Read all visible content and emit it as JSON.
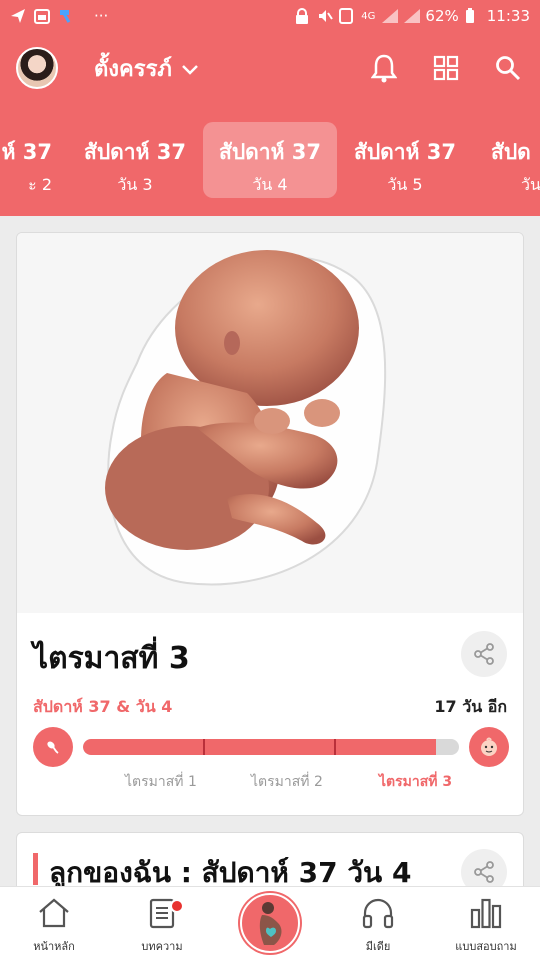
{
  "status_bar": {
    "notification_icons": [
      "paper-plane-icon",
      "calendar-icon",
      "hammer-icon",
      "more-icon"
    ],
    "more": "···",
    "battery": "62%",
    "time": "11:33",
    "network": "4G"
  },
  "app_bar": {
    "profile_name": "ตั้งครรภ์",
    "icons": [
      "bell-icon",
      "grid-icon",
      "search-icon"
    ]
  },
  "day_tabs": [
    {
      "week": "ห์ 37",
      "day": "ะ 2"
    },
    {
      "week": "สัปดาห์ 37",
      "day": "วัน 3"
    },
    {
      "week": "สัปดาห์ 37",
      "day": "วัน 4",
      "active": true
    },
    {
      "week": "สัปดาห์ 37",
      "day": "วัน 5"
    },
    {
      "week": "สัปด",
      "day": "วัน"
    }
  ],
  "progress_card": {
    "trimester_title": "ไตรมาสที่ 3",
    "week_label": "สัปดาห์ 37 & วัน 4",
    "days_left": "17 วัน อีก",
    "progress_fraction": 0.94,
    "trimester_labels": [
      "ไตรมาสที่ 1",
      "ไตรมาสที่ 2",
      "ไตรมาสที่ 3"
    ]
  },
  "article_card": {
    "title": "ลูกของฉัน : สัปดาห์ 37 วัน 4"
  },
  "bottom_nav": [
    {
      "label": "หน้าหลัก",
      "icon": "home-icon"
    },
    {
      "label": "บทความ",
      "icon": "article-icon"
    },
    {
      "label": "",
      "icon": "pregnancy-icon"
    },
    {
      "label": "มีเดีย",
      "icon": "headphones-icon"
    },
    {
      "label": "แบบสอบถาม",
      "icon": "poll-icon"
    }
  ],
  "colors": {
    "accent": "#f0686a",
    "tick": "#b9303a"
  }
}
